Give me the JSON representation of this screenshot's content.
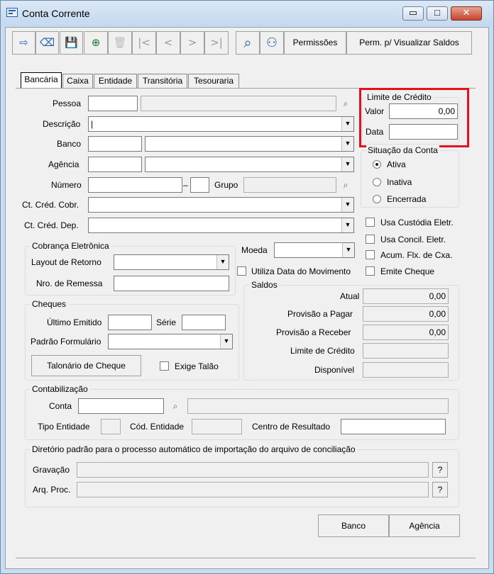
{
  "window": {
    "title": "Conta Corrente",
    "minimize": "▭",
    "maximize": "□",
    "close": "✕"
  },
  "toolbar": {
    "exit": "⇨",
    "eraser": "⌫",
    "save": "💾",
    "add": "⊕",
    "delete": "🗑",
    "first": "|<",
    "prev": "<",
    "next": ">",
    "last": ">|",
    "search": "⌕",
    "user": "⚇",
    "permissions": "Permissões",
    "perm_saldos": "Perm. p/ Visualizar Saldos"
  },
  "tabs": [
    "Bancária",
    "Caixa",
    "Entidade",
    "Transitória",
    "Tesouraria"
  ],
  "form": {
    "pessoa": "Pessoa",
    "descricao": "Descrição",
    "banco": "Banco",
    "agencia": "Agência",
    "numero": "Número",
    "dash": "–",
    "grupo": "Grupo",
    "ct_cred_cobr": "Ct. Créd. Cobr.",
    "ct_cred_dep": "Ct. Créd. Dep.",
    "moeda": "Moeda",
    "utiliza_data": "Utiliza Data do Movimento"
  },
  "limite": {
    "title": "Limite de Crédito",
    "valor_label": "Valor",
    "valor": "0,00",
    "data_label": "Data"
  },
  "situacao": {
    "title": "Situação da Conta",
    "options": [
      "Ativa",
      "Inativa",
      "Encerrada"
    ],
    "selected": "Ativa"
  },
  "checks": [
    "Usa Custódia Eletr.",
    "Usa Concil. Eletr.",
    "Acum. Flx. de Cxa.",
    "Emite Cheque"
  ],
  "cobranca": {
    "title": "Cobrança Eletrônica",
    "layout": "Layout de Retorno",
    "remessa": "Nro. de Remessa"
  },
  "cheques": {
    "title": "Cheques",
    "ultimo": "Último Emitido",
    "serie": "Série",
    "padrao": "Padrão Formulário",
    "talonario": "Talonário de Cheque",
    "exige": "Exige Talão"
  },
  "saldos": {
    "title": "Saldos",
    "rows": [
      {
        "label": "Atual",
        "value": "0,00"
      },
      {
        "label": "Provisão a Pagar",
        "value": "0,00"
      },
      {
        "label": "Provisão a Receber",
        "value": "0,00"
      },
      {
        "label": "Limite de Crédito",
        "value": ""
      },
      {
        "label": "Disponível",
        "value": ""
      }
    ]
  },
  "contabilizacao": {
    "title": "Contabilização",
    "conta": "Conta",
    "tipo_entidade": "Tipo Entidade",
    "cod_entidade": "Cód. Entidade",
    "centro": "Centro de Resultado"
  },
  "diretorio": {
    "title": "Diretório padrão para o processo automático de importação do arquivo de conciliação",
    "gravacao": "Gravação",
    "arq_proc": "Arq. Proc.",
    "browse": "?"
  },
  "footer": {
    "banco": "Banco",
    "agencia": "Agência"
  }
}
